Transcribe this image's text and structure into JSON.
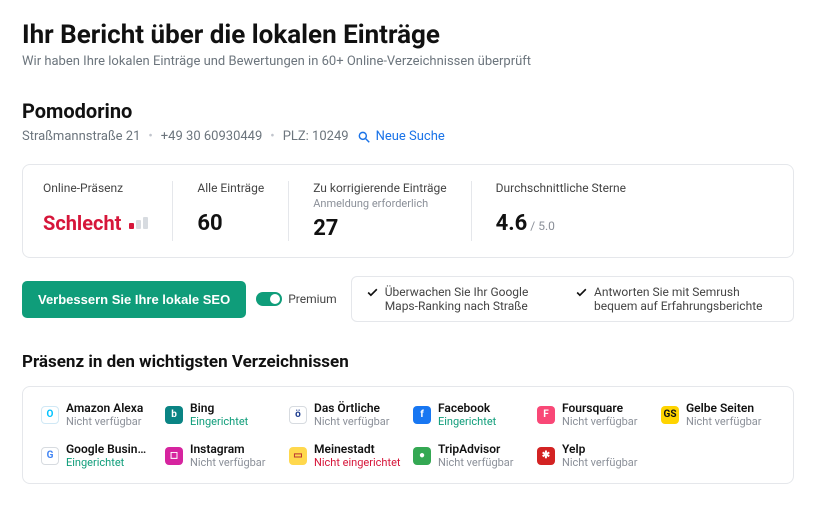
{
  "header": {
    "title": "Ihr Bericht über die lokalen Einträge",
    "subtitle": "Wir haben Ihre lokalen Einträge und Bewertungen in 60+ Online-Verzeichnissen überprüft"
  },
  "business": {
    "name": "Pomodorino",
    "address": "Straßmannstraße 21",
    "phone": "+49 30 60930449",
    "zip_label": "PLZ: 10249",
    "new_search": "Neue Suche"
  },
  "stats": {
    "presence_label": "Online-Präsenz",
    "presence_value": "Schlecht",
    "all_label": "Alle Einträge",
    "all_value": "60",
    "fix_label": "Zu korrigierende Einträge",
    "fix_sublabel": "Anmeldung erforderlich",
    "fix_value": "27",
    "rating_label": "Durchschnittliche Sterne",
    "rating_value": "4.6",
    "rating_max": " / 5.0"
  },
  "cta": {
    "button": "Verbessern Sie Ihre lokale SEO",
    "premium": "Premium",
    "benefit1": "Überwachen Sie Ihr Google Maps-Ranking nach Straße",
    "benefit2": "Antworten Sie mit Semrush bequem auf Erfahrungsberichte"
  },
  "dirs": {
    "title": "Präsenz in den wichtigsten Verzeichnissen",
    "status": {
      "na": "Nicht verfügbar",
      "ok": "Eingerichtet",
      "bad": "Nicht eingerichtet"
    },
    "items": [
      {
        "name": "Amazon Alexa",
        "status": "na",
        "icon_bg": "#ffffff",
        "icon_color": "#00c3ff",
        "icon_letter": "O",
        "icon_border": "#d0e8f5"
      },
      {
        "name": "Bing",
        "status": "ok",
        "icon_bg": "#0a8484",
        "icon_letter": "b"
      },
      {
        "name": "Das Örtliche",
        "status": "na",
        "icon_bg": "#ffffff",
        "icon_color": "#1e3d8f",
        "icon_letter": "ö",
        "icon_border": "#d7dbe0"
      },
      {
        "name": "Facebook",
        "status": "ok",
        "icon_bg": "#1877f2",
        "icon_letter": "f"
      },
      {
        "name": "Foursquare",
        "status": "na",
        "icon_bg": "#f94877",
        "icon_letter": "F"
      },
      {
        "name": "Gelbe Seiten",
        "status": "na",
        "icon_bg": "#ffd400",
        "icon_color": "#111",
        "icon_letter": "GS"
      },
      {
        "name": "Google Busin…",
        "status": "ok",
        "icon_bg": "#ffffff",
        "icon_color": "#4285f4",
        "icon_letter": "G",
        "icon_border": "#d7dbe0"
      },
      {
        "name": "Instagram",
        "status": "na",
        "icon_bg": "#d6249f",
        "icon_letter": "◻"
      },
      {
        "name": "Meinestadt",
        "status": "bad",
        "icon_bg": "#ffd84d",
        "icon_color": "#b33",
        "icon_letter": "▭"
      },
      {
        "name": "TripAdvisor",
        "status": "na",
        "icon_bg": "#34a853",
        "icon_letter": "●"
      },
      {
        "name": "Yelp",
        "status": "na",
        "icon_bg": "#d32323",
        "icon_letter": "✱"
      }
    ]
  }
}
